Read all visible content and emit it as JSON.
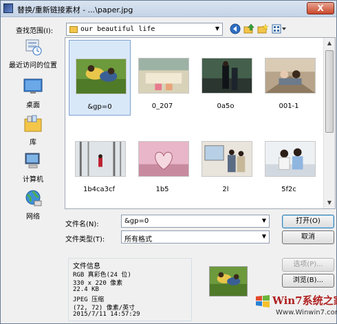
{
  "titlebar": {
    "title": "替换/重新链接素材 - ...\\paper.jpg",
    "close": "X"
  },
  "lookin": {
    "label": "查找范围(I):",
    "value": "our beautiful life"
  },
  "places": [
    {
      "name": "recent-places",
      "label": "最近访问的位置",
      "icon": "recent-places-icon"
    },
    {
      "name": "desktop",
      "label": "桌面",
      "icon": "desktop-icon"
    },
    {
      "name": "libraries",
      "label": "库",
      "icon": "library-icon"
    },
    {
      "name": "computer",
      "label": "计算机",
      "icon": "computer-icon"
    },
    {
      "name": "network",
      "label": "网络",
      "icon": "network-icon"
    }
  ],
  "files": [
    {
      "name": "&gp=0",
      "selected": true
    },
    {
      "name": "0_207"
    },
    {
      "name": "0a5o"
    },
    {
      "name": "001-1"
    },
    {
      "name": "1b4ca3cf"
    },
    {
      "name": "1b5"
    },
    {
      "name": "2l"
    },
    {
      "name": "5f2c"
    }
  ],
  "filename": {
    "label": "文件名(N):",
    "value": "&gp=0"
  },
  "filetype": {
    "label": "文件类型(T):",
    "value": "所有格式"
  },
  "buttons": {
    "open": "打开(O)",
    "cancel": "取消",
    "options": "选项(P)...",
    "browse": "浏览(B)..."
  },
  "fileinfo": {
    "header": "文件信息",
    "lines": [
      "RGB 真彩色(24 位)",
      "330 x 220 像素",
      "22.4 KB",
      "JPEG 压缩",
      "(72, 72) 像素/英寸",
      "2015/7/11  14:57:29"
    ]
  },
  "watermark": {
    "text": "Win7系统之家",
    "url": "Www.Winwin7.com"
  },
  "colors": {
    "title_bg": "#c4d3e6",
    "selection": "#d9e8f9",
    "close_red": "#c9472a"
  }
}
